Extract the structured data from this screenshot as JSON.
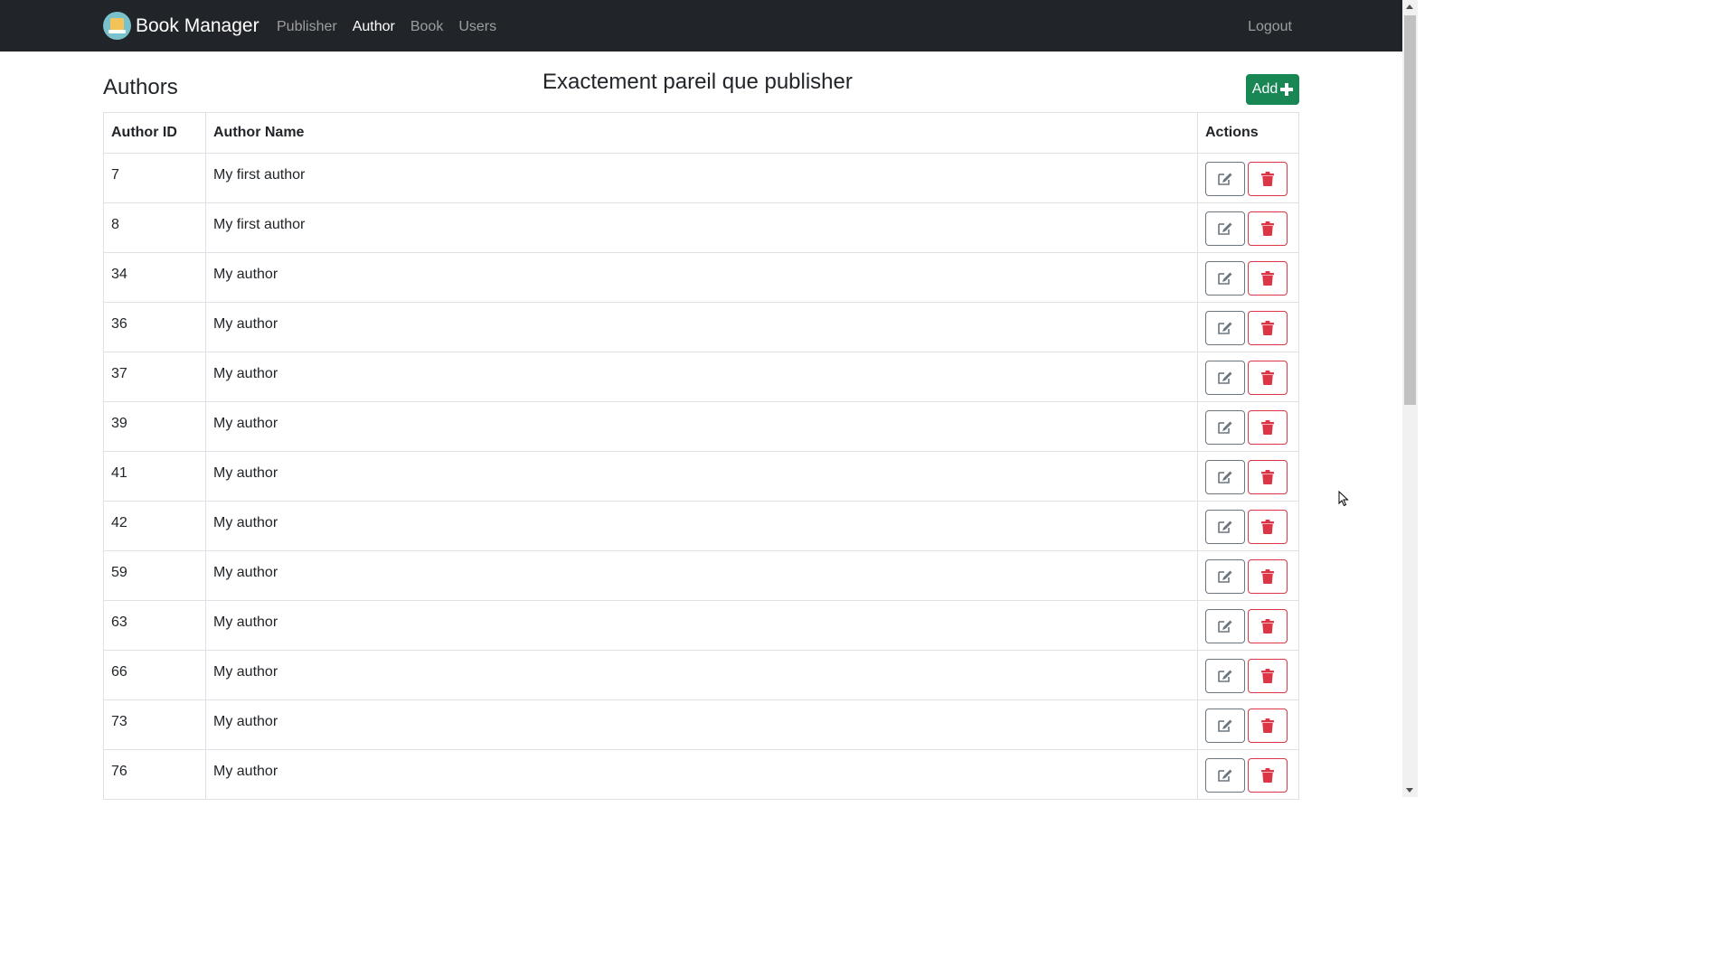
{
  "navbar": {
    "brand": "Book Manager",
    "links": [
      {
        "label": "Publisher",
        "active": false
      },
      {
        "label": "Author",
        "active": true
      },
      {
        "label": "Book",
        "active": false
      },
      {
        "label": "Users",
        "active": false
      }
    ],
    "logout": "Logout",
    "background": "#212529"
  },
  "page": {
    "heading": "Authors",
    "subtitle": "Exactement pareil que publisher",
    "add_button": "Add"
  },
  "table": {
    "headers": [
      "Author ID",
      "Author Name",
      "Actions"
    ],
    "rows": [
      {
        "id": "7",
        "name": "My first author"
      },
      {
        "id": "8",
        "name": "My first author"
      },
      {
        "id": "34",
        "name": "My author"
      },
      {
        "id": "36",
        "name": "My author"
      },
      {
        "id": "37",
        "name": "My author"
      },
      {
        "id": "39",
        "name": "My author"
      },
      {
        "id": "41",
        "name": "My author"
      },
      {
        "id": "42",
        "name": "My author"
      },
      {
        "id": "59",
        "name": "My author"
      },
      {
        "id": "63",
        "name": "My author"
      },
      {
        "id": "66",
        "name": "My author"
      },
      {
        "id": "73",
        "name": "My author"
      },
      {
        "id": "76",
        "name": "My author"
      }
    ],
    "row_actions": [
      {
        "icon": "edit-icon",
        "color": "#6c757d"
      },
      {
        "icon": "trash-icon",
        "color": "#dc3545"
      }
    ]
  },
  "colors": {
    "add_button": "#198754",
    "delete": "#dc3545",
    "edit": "#6c757d"
  }
}
